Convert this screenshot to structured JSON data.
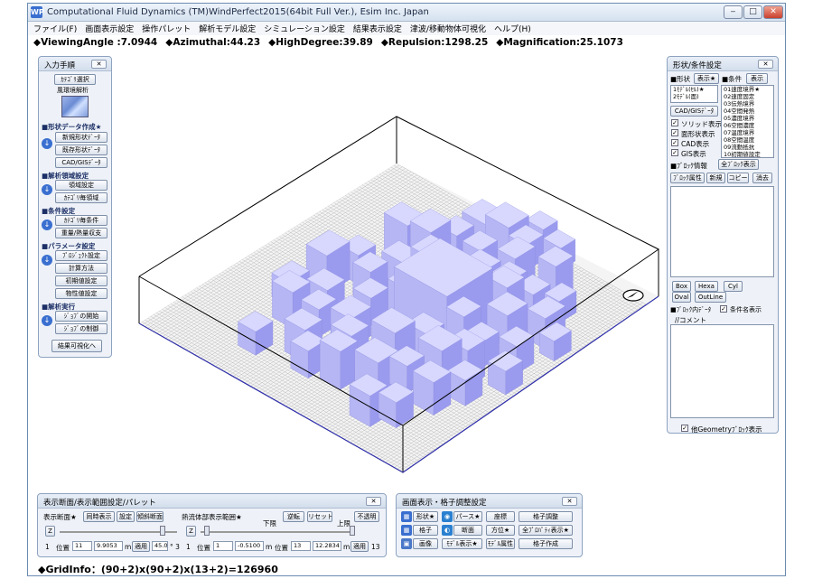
{
  "window": {
    "title": "Computational Fluid Dynamics (TM)WindPerfect2015(64bit Full Ver.), Esim Inc. Japan",
    "app_icon": "WP",
    "controls": [
      "‒",
      "□",
      "✕"
    ]
  },
  "menu": [
    "ファイル(F)",
    "画面表示設定",
    "操作パレット",
    "解析モデル設定",
    "シミュレーション設定",
    "結果表示設定",
    "津波/移動物体可視化",
    "ヘルプ(H)"
  ],
  "status": {
    "viewing_angle": "◆ViewingAngle :7.0944",
    "azimuthal": "◆Azimuthal:44.23",
    "high_degree": "◆HighDegree:39.89",
    "repulsion": "◆Repulsion:1298.25",
    "magnification": "◆Magnification:25.1073"
  },
  "input_panel": {
    "title": "入力手順",
    "close": "✕",
    "category_select": "ｶﾃｺﾞﾘ選択",
    "category_value": "風環境解析",
    "sections": {
      "shape": "■形状データ作成★",
      "analysis": "■解析領域設定",
      "conditions": "■条件設定",
      "parameters": "■パラメータ設定",
      "run": "■解析実行"
    },
    "buttons": {
      "new_shape": "新規形状ﾃﾞｰﾀ",
      "existing_shape": "既存形状ﾃﾞｰﾀ",
      "cad_gis": "CAD/GISﾃﾞｰﾀ",
      "region_setting": "領域設定",
      "category_region": "ｶﾃｺﾞﾘ毎領域",
      "category_condition": "ｶﾃｺﾞﾘ毎条件",
      "gravity_heat": "重量/熱量収支",
      "project_setting": "ﾌﾟﾛｼﾞｪｸﾄ設定",
      "calc_method": "計算方法",
      "initial_value": "初期値設定",
      "property": "物性値設定",
      "job_start": "ｼﾞｮﾌﾞの開始",
      "job_control": "ｼﾞｮﾌﾞの制御",
      "to_results": "結果可視化へ"
    }
  },
  "shape_panel": {
    "title": "形状/条件設定",
    "close": "✕",
    "shape_label": "■形状",
    "condition_label": "■条件",
    "display_button": "表示★",
    "display_button2": "表示",
    "shape_list": [
      "1ﾓﾃﾞﾙ(ｾﾙ)★",
      "2ﾓﾃﾞﾙ(面)"
    ],
    "condition_list": [
      "01速度境界★",
      "02速度固定",
      "03伝熱境界",
      "04空間発熱",
      "05濃度境界",
      "06空間濃度",
      "07温度境界",
      "08空間温度",
      "09流動抵抗",
      "10初期値設定"
    ],
    "cad_gis_button": "CAD/GISﾃﾞｰﾀ",
    "checks": [
      "ソリッド表示",
      "面形状表示",
      "CAD表示",
      "GIS表示"
    ],
    "block_info": "■ﾌﾞﾛｯｸ情報",
    "all_blocks": "全ﾌﾞﾛｯｸ表示",
    "block_attr": "ﾌﾞﾛｯｸ属性",
    "new": "新規",
    "copy": "コピー",
    "delete": "消去",
    "shape_buttons": [
      "Box",
      "Hexa",
      "Cyl",
      "Oval",
      "OutLine"
    ],
    "block_data": "■ﾌﾞﾛｯｸ内ﾃﾞｰﾀ",
    "condition_name_display": "条件名表示",
    "comment": "//コメント",
    "other_geometry": "他Geometryﾌﾞﾛｯｸ表示"
  },
  "palette": {
    "title": "表示断面/表示範囲設定/パレット",
    "close": "✕",
    "section_label": "表示断面★",
    "sync_display": "同時表示",
    "setting": "設定",
    "oblique_section": "傾斜断面",
    "fluid_range": "熱流体部表示範囲★",
    "lower": "下限",
    "upper": "上限",
    "reverse": "逆転",
    "reset": "リセット",
    "opaque": "不透明",
    "axis": "Z",
    "axis2": "Z",
    "row_left": {
      "index": "1",
      "pos_label": "位置",
      "pos_value": "11",
      "value": "9.9053",
      "unit": "m",
      "apply": "適用",
      "angle1": "45.0",
      "angle2": "° 3"
    },
    "row_mid": {
      "index": "1",
      "pos_label": "位置",
      "pos_value": "1",
      "value": "-0.5100",
      "unit": "m"
    },
    "row_right": {
      "pos_label": "位置",
      "pos_value": "13",
      "value": "12.2834",
      "unit": "m",
      "apply": "適用",
      "index": "13"
    }
  },
  "display_panel": {
    "title": "画面表示・格子調整設定",
    "close": "✕",
    "rows": [
      [
        "形状★",
        "パース★",
        "座標",
        "格子調整"
      ],
      [
        "格子",
        "断面",
        "方位★",
        "全ﾌﾟﾛﾊﾟﾃｨ表示★"
      ],
      [
        "画像",
        "ﾓﾃﾞﾙ表示★",
        "ﾓﾃﾞﾙ属性",
        "格子作成"
      ]
    ]
  },
  "grid_info": "◆GridInfo：(90+2)x(90+2)x(13+2)=126960",
  "colors": {
    "building_top": "#d8d8ff",
    "building_left": "#b6b6f4",
    "building_right": "#9a9aee",
    "grid_line": "#b0b0b0",
    "panel_bg": "#eef2f8",
    "accent": "#3a6fd0"
  }
}
